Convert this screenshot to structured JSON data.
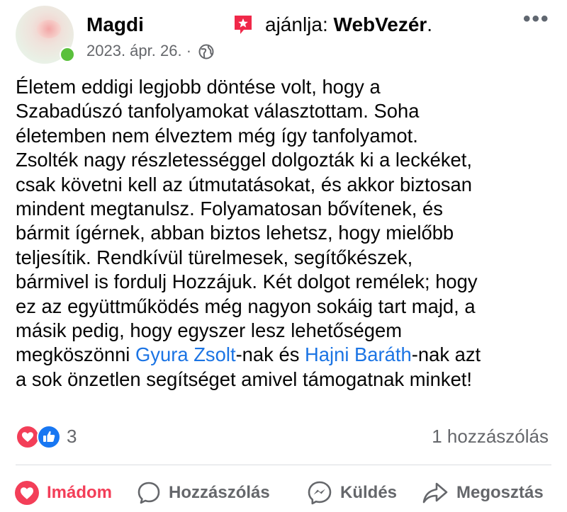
{
  "post": {
    "author": "Magdi",
    "recommends_prefix": "ajánlja:",
    "recommends_page": "WebVezér",
    "recommends_suffix": ".",
    "date": "2023. ápr. 26.",
    "dot": "·",
    "more": "•••",
    "text_part1": "Életem eddigi legjobb döntése volt, hogy a\nSzabadúszó tanfolyamokat választottam. Soha\néletemben nem élveztem még így tanfolyamot.\nZsolték nagy részletességgel dolgozták ki a leckéket,\ncsak követni kell az útmutatásokat, és akkor biztosan\nmindent megtanulsz. Folyamatosan bővítenek, és\nbármit ígérnek, abban biztos lehetsz, hogy mielőbb\nteljesítik. Rendkívül türelmesek, segítőkészek,\nbármivel is fordulj Hozzájuk. Két dolgot remélek; hogy\nez az együttműködés még nagyon sokáig tart majd, a\nmásik pedig, hogy egyszer lesz lehetőségem\nmegköszönni ",
    "mention1": "Gyura Zsolt",
    "text_part2": "-nak és ",
    "mention2": "Hajni Baráth",
    "text_part3": "-nak azt\na sok önzetlen segítséget amivel támogatnak minket!"
  },
  "stats": {
    "reaction_count": "3",
    "comment_count": "1 hozzászólás"
  },
  "actions": {
    "love": "Imádom",
    "comment": "Hozzászólás",
    "send": "Küldés",
    "share": "Megosztás"
  },
  "colors": {
    "love": "#f33e58",
    "like": "#1877f2",
    "link": "#1b74e4",
    "secondary_text": "#65676b",
    "recommend_icon": "#f02849"
  },
  "icons": {
    "recommend": "star-badge-icon",
    "privacy": "globe-icon",
    "reaction_love": "heart-icon",
    "reaction_like": "thumbs-up-icon",
    "action_love": "heart-icon",
    "action_comment": "speech-bubble-icon",
    "action_send": "messenger-icon",
    "action_share": "share-arrow-icon"
  }
}
